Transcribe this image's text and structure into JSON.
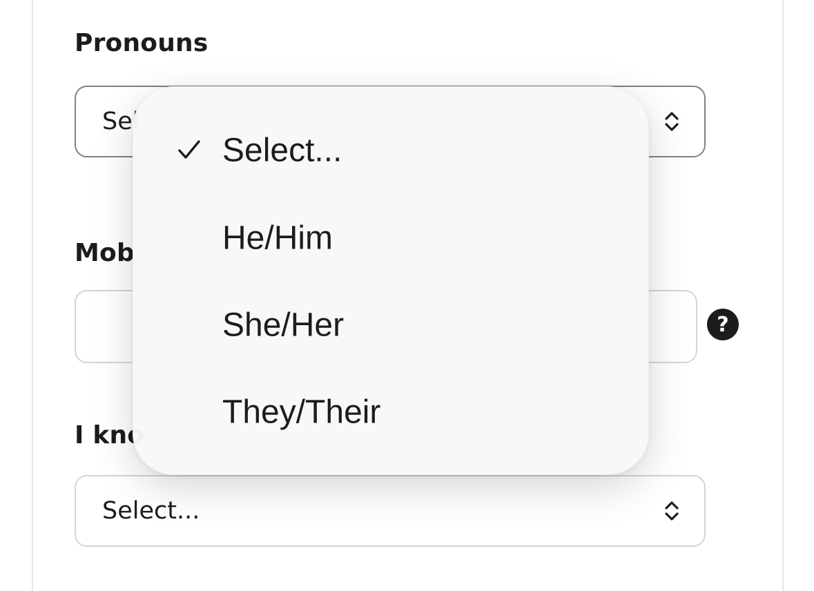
{
  "form": {
    "pronouns_label": "Pronouns",
    "pronouns_value": "Sel",
    "mobile_label": "Mob",
    "mobile_value": "",
    "know_label": "I kno",
    "know_value": "Select..."
  },
  "dropdown": {
    "options": [
      {
        "label": "Select...",
        "selected": true
      },
      {
        "label": "He/Him",
        "selected": false
      },
      {
        "label": "She/Her",
        "selected": false
      },
      {
        "label": "They/Their",
        "selected": false
      }
    ]
  },
  "colors": {
    "accent_border": "#7a8290",
    "input_border": "#d4d4d8",
    "text": "#1c1c1e",
    "dropdown_bg": "#f8f8f9"
  },
  "icons": {
    "select_chevron": "chevron-up-down-icon",
    "check": "checkmark-icon",
    "help": "question-circle-icon"
  }
}
